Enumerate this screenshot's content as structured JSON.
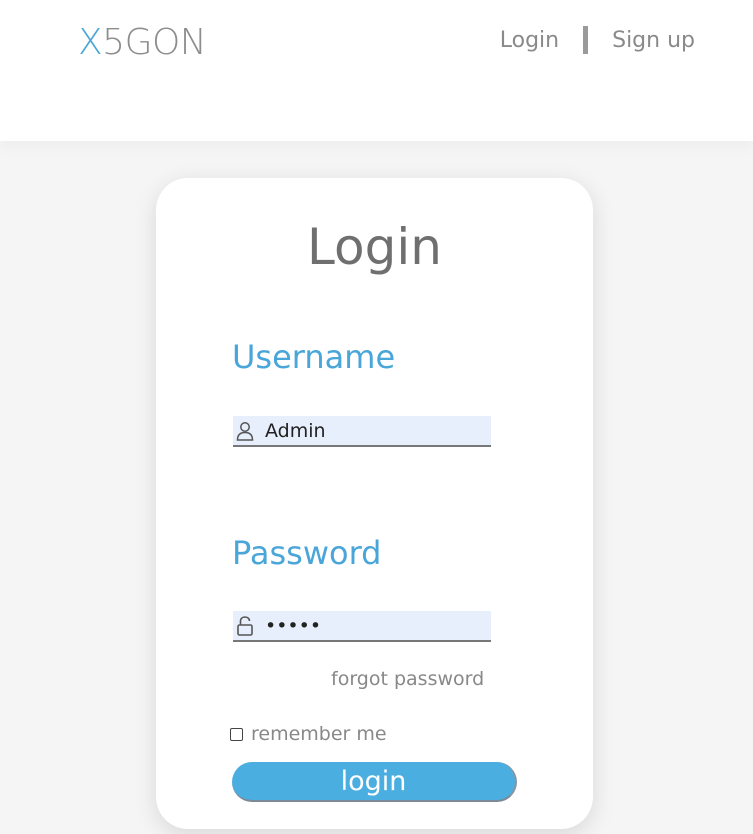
{
  "header": {
    "logo_prefix": "X",
    "logo_rest": "5GON",
    "nav_login": "Login",
    "nav_signup": "Sign up"
  },
  "card": {
    "title": "Login",
    "username_label": "Username",
    "username_value": "Admin",
    "password_label": "Password",
    "password_value": "•••••",
    "forgot_label": "forgot password",
    "remember_label": "remember me",
    "remember_checked": false,
    "login_button": "login"
  },
  "icons": {
    "username": "user-icon",
    "password": "unlock-icon"
  },
  "colors": {
    "accent": "#4aa6d9",
    "button": "#4aaee0",
    "field_bg": "#e7effc",
    "page_bg": "#f6f5f5"
  }
}
